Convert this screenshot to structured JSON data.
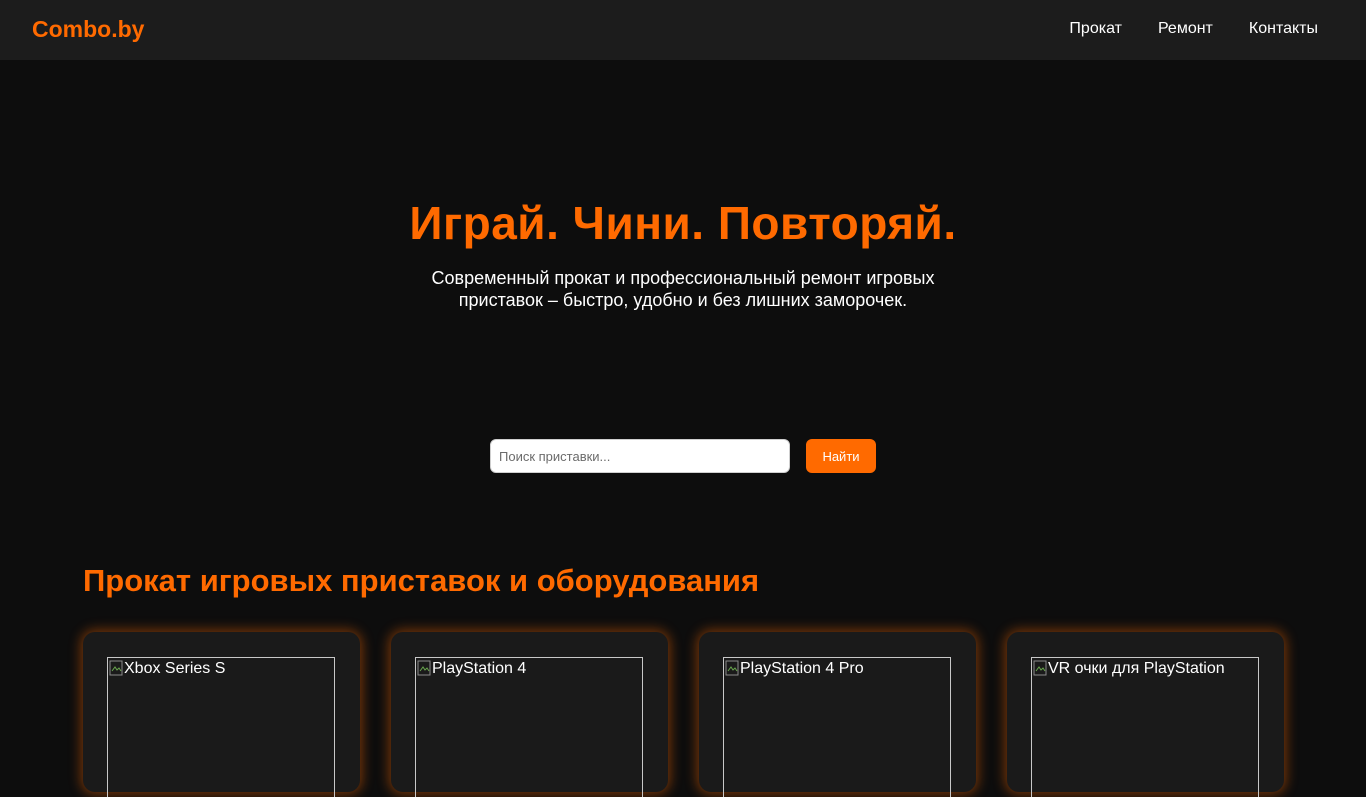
{
  "header": {
    "logo": "Combo.by",
    "nav": [
      "Прокат",
      "Ремонт",
      "Контакты"
    ]
  },
  "hero": {
    "title": "Играй. Чини. Повторяй.",
    "subtitle": "Современный прокат и профессиональный ремонт игровых приставок – быстро, удобно и без лишних заморочек."
  },
  "search": {
    "placeholder": "Поиск приставки...",
    "button_label": "Найти"
  },
  "rental": {
    "title": "Прокат игровых приставок и оборудования",
    "cards": [
      {
        "image_alt": "Xbox Series S"
      },
      {
        "image_alt": "PlayStation 4"
      },
      {
        "image_alt": "PlayStation 4 Pro"
      },
      {
        "image_alt": "VR очки для PlayStation"
      }
    ]
  },
  "colors": {
    "accent": "#ff6a00",
    "background": "#0d0d0d",
    "navbar": "#1c1c1c",
    "card": "#1a1a1a"
  }
}
